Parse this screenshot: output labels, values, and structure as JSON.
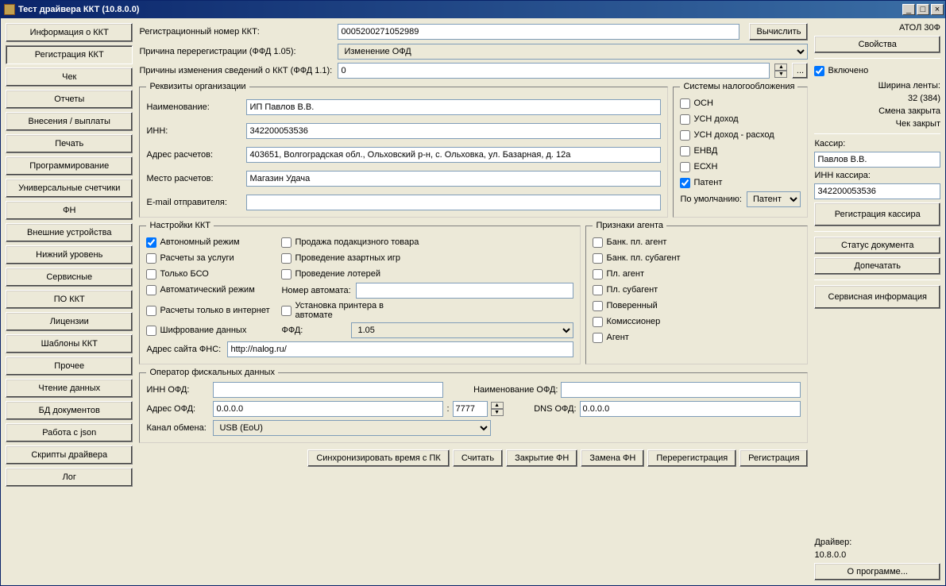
{
  "titlebar": {
    "text": "Тест драйвера ККТ (10.8.0.0)"
  },
  "nav": {
    "items": [
      "Информация о ККТ",
      "Регистрация ККТ",
      "Чек",
      "Отчеты",
      "Внесения / выплаты",
      "Печать",
      "Программирование",
      "Универсальные счетчики",
      "ФН",
      "Внешние устройства",
      "Нижний уровень",
      "Сервисные",
      "ПО ККТ",
      "Лицензии",
      "Шаблоны ККТ",
      "Прочее",
      "Чтение данных",
      "БД документов",
      "Работа с json",
      "Скрипты драйвера",
      "Лог"
    ],
    "active_index": 1
  },
  "top": {
    "reg_no_label": "Регистрационный номер ККТ:",
    "reg_no": "0005200271052989",
    "calc_label": "Вычислить",
    "rereg_reason_label": "Причина перерегистрации (ФФД 1.05):",
    "rereg_reason": "Изменение ОФД",
    "change_reasons_label": "Причины изменения сведений о ККТ (ФФД 1.1):",
    "change_reasons": "0",
    "ellipsis": "..."
  },
  "org": {
    "legend": "Реквизиты организации",
    "name_label": "Наименование:",
    "name": "ИП Павлов В.В.",
    "inn_label": "ИНН:",
    "inn": "342200053536",
    "addr_label": "Адрес расчетов:",
    "addr": "403651, Волгоградская обл., Ольховский р-н, с. Ольховка, ул. Базарная, д. 12а",
    "place_label": "Место расчетов:",
    "place": "Магазин Удача",
    "email_label": "E-mail отправителя:",
    "email": ""
  },
  "tax": {
    "legend": "Системы налогообложения",
    "items": [
      {
        "label": "ОСН",
        "checked": false
      },
      {
        "label": "УСН доход",
        "checked": false
      },
      {
        "label": "УСН доход - расход",
        "checked": false
      },
      {
        "label": "ЕНВД",
        "checked": false
      },
      {
        "label": "ЕСХН",
        "checked": false
      },
      {
        "label": "Патент",
        "checked": true
      }
    ],
    "default_label": "По умолчанию:",
    "default": "Патент"
  },
  "kkt": {
    "legend": "Настройки ККТ",
    "items_left": [
      {
        "label": "Автономный режим",
        "checked": true
      },
      {
        "label": "Расчеты за услуги",
        "checked": false
      },
      {
        "label": "Только БСО",
        "checked": false
      },
      {
        "label": "Автоматический режим",
        "checked": false
      }
    ],
    "items_right": [
      {
        "label": "Продажа подакцизного товара",
        "checked": false
      },
      {
        "label": "Проведение азартных игр",
        "checked": false
      },
      {
        "label": "Проведение лотерей",
        "checked": false
      }
    ],
    "machine_no_label": "Номер автомата:",
    "machine_no": "",
    "internet_only": "Расчеты только в интернет",
    "printer_auto": "Установка принтера в автомате",
    "encrypt": "Шифрование данных",
    "ffd_label": "ФФД:",
    "ffd": "1.05",
    "fns_label": "Адрес сайта ФНС:",
    "fns": "http://nalog.ru/"
  },
  "agent": {
    "legend": "Признаки агента",
    "items": [
      {
        "label": "Банк. пл. агент",
        "checked": false
      },
      {
        "label": "Банк. пл. субагент",
        "checked": false
      },
      {
        "label": "Пл. агент",
        "checked": false
      },
      {
        "label": "Пл. субагент",
        "checked": false
      },
      {
        "label": "Поверенный",
        "checked": false
      },
      {
        "label": "Комиссионер",
        "checked": false
      },
      {
        "label": "Агент",
        "checked": false
      }
    ]
  },
  "ofd": {
    "legend": "Оператор фискальных данных",
    "inn_label": "ИНН ОФД:",
    "inn": "",
    "name_label": "Наименование ОФД:",
    "name": "",
    "addr_label": "Адрес ОФД:",
    "addr": "0.0.0.0",
    "port": "7777",
    "dns_label": "DNS ОФД:",
    "dns": "0.0.0.0",
    "channel_label": "Канал обмена:",
    "channel": "USB (EoU)"
  },
  "footer": {
    "buttons": [
      "Синхронизировать время с ПК",
      "Считать",
      "Закрытие ФН",
      "Замена ФН",
      "Перерегистрация",
      "Регистрация"
    ]
  },
  "side": {
    "device": "АТОЛ 30Ф",
    "properties": "Свойства",
    "enabled": "Включено",
    "tape_label": "Ширина ленты:",
    "tape": "32 (384)",
    "shift": "Смена закрыта",
    "cheque": "Чек закрыт",
    "cashier_label": "Кассир:",
    "cashier": "Павлов В.В.",
    "cashier_inn_label": "ИНН кассира:",
    "cashier_inn": "342200053536",
    "reg_cashier": "Регистрация кассира",
    "doc_status": "Статус документа",
    "reprint": "Допечатать",
    "service_info": "Сервисная информация",
    "driver": "Драйвер:",
    "driver_ver": "10.8.0.0",
    "about": "О программе..."
  }
}
